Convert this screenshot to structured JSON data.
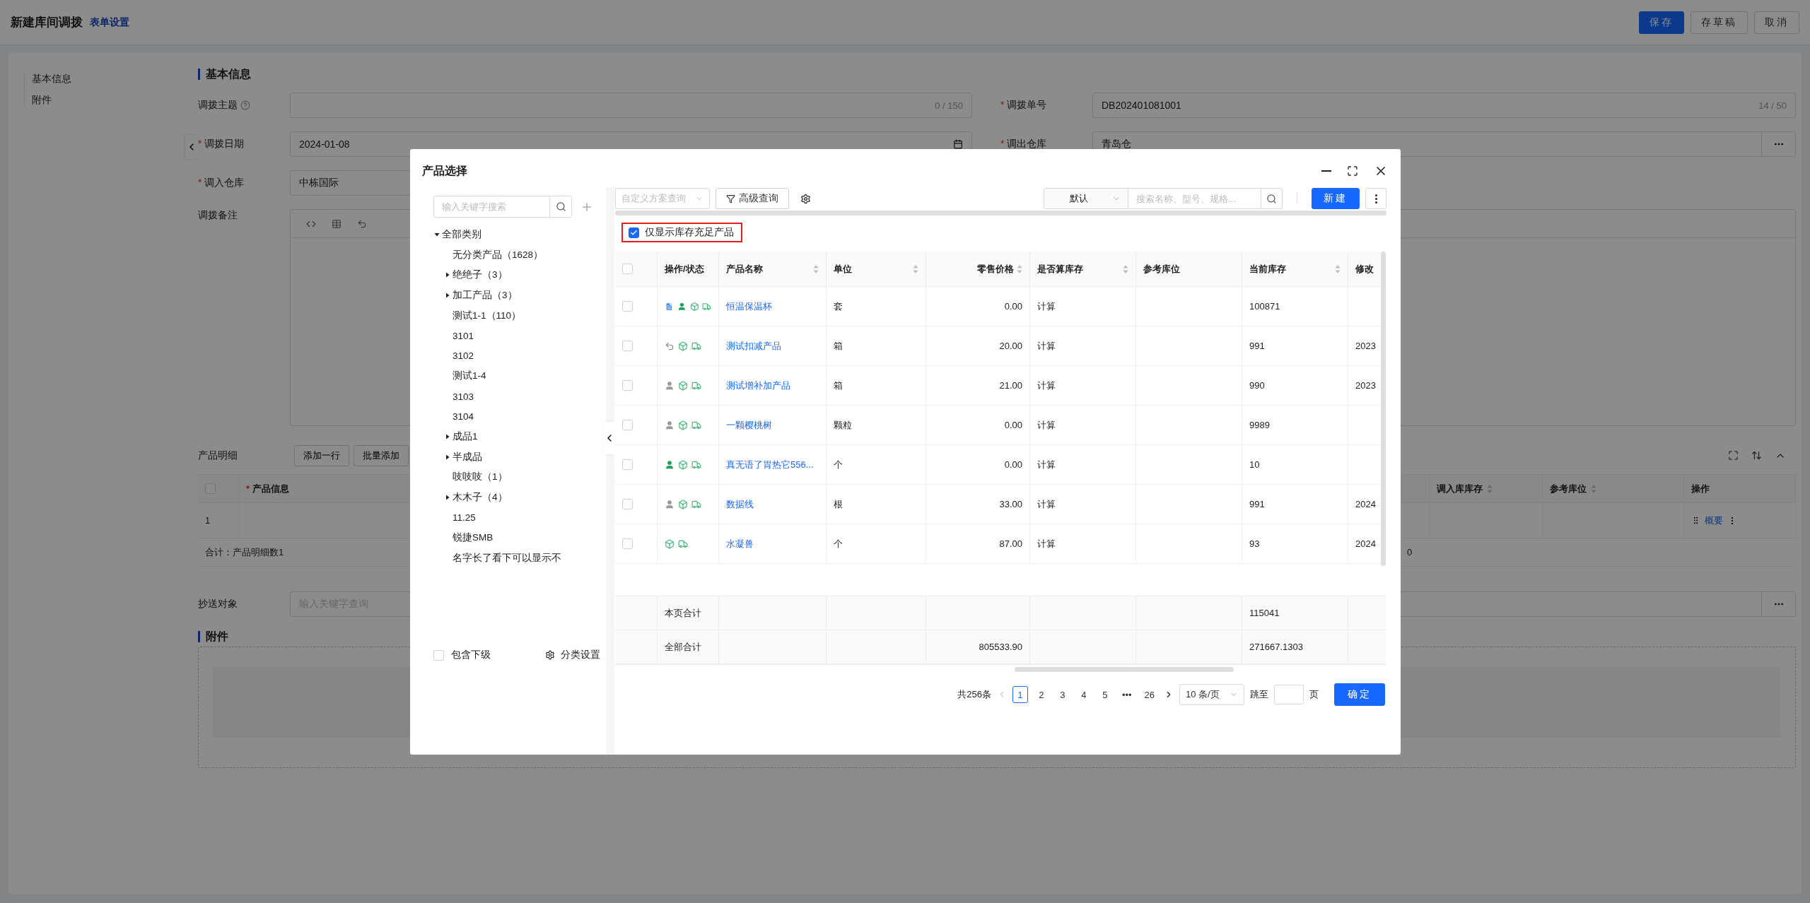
{
  "page": {
    "title": "新建库间调拨",
    "link": "表单设置",
    "buttons": [
      {
        "label": "保存",
        "kind": "primary"
      },
      {
        "label": "存草稿",
        "kind": "default"
      },
      {
        "label": "取消",
        "kind": "default"
      }
    ]
  },
  "nav": [
    "基本信息",
    "附件"
  ],
  "basic": {
    "title": "基本信息",
    "fields": [
      {
        "label": "调拨主题",
        "help": true,
        "kind": "text",
        "counter": "0 / 150"
      },
      {
        "mark": "*",
        "label": "调拨单号",
        "help": false,
        "kind": "text",
        "value": "DB202401081001",
        "counter": "14 / 50"
      },
      {
        "mark": "*",
        "label": "调拨日期",
        "help": false,
        "kind": "date",
        "value": "2024-01-08"
      },
      {
        "mark": "*",
        "label": "调出仓库",
        "help": false,
        "kind": "picker",
        "value": "青岛仓"
      },
      {
        "mark": "*",
        "label": "调入仓库",
        "help": false,
        "kind": "text",
        "value": "中栋国际"
      }
    ],
    "remark": {
      "label": "调拨备注"
    }
  },
  "details": {
    "title": "产品明细",
    "buttons": [
      "添加一行",
      "批量添加"
    ],
    "header_checked": false,
    "columns": [
      {
        "mark": "*",
        "label": "产品信息",
        "sortable": false
      },
      {
        "label": "调入库库存",
        "sortable": true
      },
      {
        "label": "参考库位",
        "sortable": true
      },
      {
        "label": "操作",
        "sortable": false
      }
    ],
    "rows": [
      {
        "index": "1",
        "action": "概要"
      }
    ],
    "summary": {
      "label": "合计：产品明细数1",
      "stock": "0"
    }
  },
  "cc": {
    "label": "抄送对象",
    "placeholder": "输入关键字查询"
  },
  "attachment": {
    "title": "附件"
  },
  "modal": {
    "title": "产品选择",
    "tree": {
      "placeholder": "输入关键字搜索",
      "items": [
        {
          "label": "全部类别",
          "expanded": true,
          "children": [
            {
              "label": "无分类产品（1628）"
            },
            {
              "label": "绝绝子（3）",
              "expanded": false
            },
            {
              "label": "加工产品（3）",
              "expanded": false
            },
            {
              "label": "测试1-1（110）"
            },
            {
              "label": "3101"
            },
            {
              "label": "3102"
            },
            {
              "label": "测试1-4"
            },
            {
              "label": "3103"
            },
            {
              "label": "3104"
            },
            {
              "label": "成品1",
              "expanded": false
            },
            {
              "label": "半成品",
              "expanded": false
            },
            {
              "label": "吱吱吱（1）"
            },
            {
              "label": "木木子（4）",
              "expanded": false
            },
            {
              "label": "11.25"
            },
            {
              "label": "锐捷SMB"
            },
            {
              "label": "名字长了看下可以显示不"
            }
          ]
        }
      ],
      "include_sub": {
        "label": "包含下级",
        "checked": false
      },
      "settings": "分类设置"
    },
    "toolbar": {
      "scheme_placeholder": "自定义方案查询",
      "advanced": "高级查询",
      "sort": "默认",
      "search_placeholder": "搜索名称、型号、规格...",
      "new": "新建"
    },
    "filter": {
      "label": "仅显示库存充足产品",
      "checked": true
    },
    "table": {
      "header_checked": false,
      "columns": [
        {
          "label": "操作/状态",
          "sortable": false,
          "kind": "text"
        },
        {
          "label": "产品名称",
          "sortable": true,
          "kind": "text"
        },
        {
          "label": "单位",
          "sortable": true,
          "kind": "text"
        },
        {
          "label": "零售价格",
          "sortable": true,
          "kind": "number"
        },
        {
          "label": "是否算库存",
          "sortable": true,
          "kind": "text"
        },
        {
          "label": "参考库位",
          "sortable": false,
          "kind": "text"
        },
        {
          "label": "当前库存",
          "sortable": true,
          "kind": "text"
        },
        {
          "label": "修改",
          "sortable": false,
          "kind": "text"
        }
      ],
      "rows": [
        {
          "selected": false,
          "status": [
            {
              "kind": "doc"
            },
            {
              "kind": "user_on"
            },
            {
              "kind": "box"
            },
            {
              "kind": "truck"
            }
          ],
          "name": "恒温保温杯",
          "unit": "套",
          "price": "0.00",
          "count": "计算",
          "stock": "100871"
        },
        {
          "selected": false,
          "status": [
            {
              "kind": "undo"
            },
            {
              "kind": "box"
            },
            {
              "kind": "truck"
            }
          ],
          "name": "测试扣减产品",
          "unit": "箱",
          "price": "20.00",
          "count": "计算",
          "stock": "991",
          "modified": "2023"
        },
        {
          "selected": false,
          "status": [
            {
              "kind": "user_off"
            },
            {
              "kind": "box"
            },
            {
              "kind": "truck"
            }
          ],
          "name": "测试增补加产品",
          "unit": "箱",
          "price": "21.00",
          "count": "计算",
          "stock": "990",
          "modified": "2023"
        },
        {
          "selected": false,
          "status": [
            {
              "kind": "user_off"
            },
            {
              "kind": "box"
            },
            {
              "kind": "truck"
            }
          ],
          "name": "一颗樱桃树",
          "unit": "颗粒",
          "price": "0.00",
          "count": "计算",
          "stock": "9989"
        },
        {
          "selected": false,
          "status": [
            {
              "kind": "user_on"
            },
            {
              "kind": "box"
            },
            {
              "kind": "truck"
            }
          ],
          "name": "真无语了胃热它556...",
          "unit": "个",
          "price": "0.00",
          "count": "计算",
          "stock": "10"
        },
        {
          "selected": false,
          "status": [
            {
              "kind": "user_off"
            },
            {
              "kind": "box"
            },
            {
              "kind": "truck"
            }
          ],
          "name": "数据线",
          "unit": "根",
          "price": "33.00",
          "count": "计算",
          "stock": "991",
          "modified": "2024"
        },
        {
          "selected": false,
          "status": [
            {
              "kind": "box"
            },
            {
              "kind": "truck"
            }
          ],
          "name": "水凝兽",
          "unit": "个",
          "price": "87.00",
          "count": "计算",
          "stock": "93",
          "modified": "2024"
        }
      ],
      "totals": [
        {
          "label": "本页合计",
          "stock": "115041"
        },
        {
          "label": "全部合计",
          "price": "805533.90",
          "stock": "271667.1303"
        }
      ]
    },
    "pagination": {
      "total": "共256条",
      "pages": [
        {
          "label": "1",
          "selected": true
        },
        {
          "label": "2",
          "selected": false
        },
        {
          "label": "3",
          "selected": false
        },
        {
          "label": "4",
          "selected": false
        },
        {
          "label": "5",
          "selected": false
        },
        {
          "label": "•••",
          "selected": false
        },
        {
          "label": "26",
          "selected": false
        }
      ],
      "page_size": "10 条/页",
      "jump_label": "跳至",
      "jump_suffix": "页",
      "confirm": "确定"
    }
  }
}
